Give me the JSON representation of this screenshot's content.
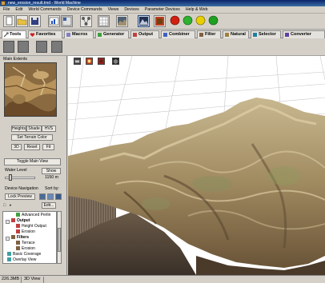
{
  "window": {
    "title": "new_erosion_result.tmd - World Machine"
  },
  "menu": {
    "items": [
      "File",
      "Edit",
      "World Commands",
      "Device Commands",
      "Views",
      "Devices",
      "Parameter Devices",
      "Help & Web"
    ]
  },
  "toolbar": {
    "buttons": [
      {
        "icon": "new-file-icon"
      },
      {
        "icon": "open-folder-icon"
      },
      {
        "icon": "save-icon"
      },
      {
        "icon": "chart-view-icon"
      },
      {
        "icon": "layout-view-icon"
      },
      {
        "icon": "network-icon"
      },
      {
        "icon": "grid-icon"
      },
      {
        "icon": "terrain-view-icon"
      },
      {
        "icon": "paint-icon"
      },
      {
        "icon": "build-red-icon"
      },
      {
        "icon": "build-green-icon"
      },
      {
        "icon": "build-yellow-icon"
      },
      {
        "icon": "build-green-icon"
      }
    ],
    "status_colors": {
      "red": "#d02010",
      "yellow": "#e8d000",
      "green": "#20a020"
    }
  },
  "tabs": [
    {
      "label": "Tools",
      "icon": "tools-icon"
    },
    {
      "label": "Favorites",
      "icon": "heart-icon"
    },
    {
      "label": "Macros",
      "icon": "macro-icon"
    },
    {
      "label": "Generator",
      "icon": "generator-icon"
    },
    {
      "label": "Output",
      "icon": "output-icon"
    },
    {
      "label": "Combiner",
      "icon": "combiner-icon"
    },
    {
      "label": "Filter",
      "icon": "filter-icon"
    },
    {
      "label": "Natural",
      "icon": "natural-icon"
    },
    {
      "label": "Selector",
      "icon": "selector-icon"
    },
    {
      "label": "Converter",
      "icon": "converter-icon"
    }
  ],
  "left_panel": {
    "main_extents_label": "Main Extents",
    "heights_label": "Heights",
    "shade_label": "Shade",
    "hvs_label": "HVS",
    "set_terrain_color": "Set Terrain Color",
    "btn_3d": "3D",
    "btn_reset": "Reset",
    "btn_fit": "Fit",
    "toggle_main_view": "Toggle Main View",
    "water_level_label": "Water Level",
    "show_button": "Show",
    "water_level_value": "1150 m",
    "device_navigation_label": "Device Navigation",
    "sort_by_label": "Sort by:",
    "lock_preview": "Lock Preview",
    "edit_button": "Edit..."
  },
  "tree": {
    "items": [
      {
        "label": "Advanced Perlin",
        "bold": false,
        "indent": 2
      },
      {
        "label": "Output",
        "bold": true,
        "indent": 1
      },
      {
        "label": "Height Output",
        "bold": false,
        "indent": 2
      },
      {
        "label": "Erosion",
        "bold": false,
        "indent": 2
      },
      {
        "label": "Filters",
        "bold": true,
        "indent": 1
      },
      {
        "label": "Terrace",
        "bold": false,
        "indent": 2
      },
      {
        "label": "Erosion",
        "bold": false,
        "indent": 2
      },
      {
        "label": "Basic Coverage",
        "bold": false,
        "indent": 1
      },
      {
        "label": "Overlay View",
        "bold": false,
        "indent": 1
      }
    ]
  },
  "status": {
    "memory": "226.3MB",
    "view": "3D View"
  }
}
